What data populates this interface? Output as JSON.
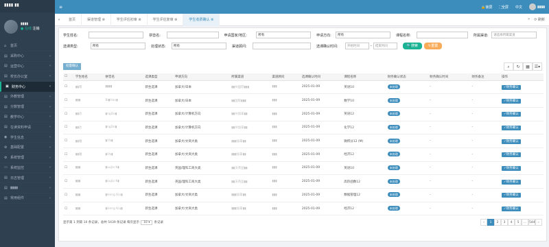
{
  "app": {
    "logo": "▮▮▮▮ ▮▮"
  },
  "user": {
    "name": "▮▮▮▮",
    "status": "● 在线",
    "logout": "注销"
  },
  "sidebar": {
    "items": [
      {
        "label": "首页",
        "icon": "home-icon",
        "glyph": "⌂"
      },
      {
        "label": "采购中心",
        "icon": "folder-icon",
        "glyph": "▤"
      },
      {
        "label": "运营中心",
        "icon": "folder-icon",
        "glyph": "▤"
      },
      {
        "label": "校长办公室",
        "icon": "folder-icon",
        "glyph": "▤"
      },
      {
        "label": "财务中心",
        "icon": "money-icon",
        "glyph": "▣",
        "active": true
      },
      {
        "label": "外教管理",
        "icon": "folder-icon",
        "glyph": "▤"
      },
      {
        "label": "分数管理",
        "icon": "folder-icon",
        "glyph": "▤"
      },
      {
        "label": "教学中心",
        "icon": "folder-icon",
        "glyph": "▤"
      },
      {
        "label": "在读资料申请",
        "icon": "folder-icon",
        "glyph": "▤"
      },
      {
        "label": "学生信息",
        "icon": "user-icon",
        "glyph": "◉"
      },
      {
        "label": "基础配置",
        "icon": "gear-icon",
        "glyph": "⚙"
      },
      {
        "label": "系统管理",
        "icon": "gear-icon",
        "glyph": "⚙"
      },
      {
        "label": "系统监控",
        "icon": "monitor-icon",
        "glyph": "▭"
      },
      {
        "label": "日志管理",
        "icon": "log-icon",
        "glyph": "▤"
      },
      {
        "label": "▮▮▮▮",
        "icon": "folder-icon",
        "glyph": "▤"
      },
      {
        "label": "常用组件",
        "icon": "folder-icon",
        "glyph": "▤"
      }
    ]
  },
  "topbar": {
    "lock": "🔒锁屏",
    "fullscreen": "⛶全屏",
    "lang": "中文",
    "username": "▮▮▮▮"
  },
  "tabs": {
    "items": [
      "首页",
      "渠道管理 ⊗",
      "学生评估初审 ⊗",
      "学生评估复审 ⊗",
      "学生收费确认 ⊗"
    ],
    "active_index": 4,
    "refresh": "⟳ 刷新",
    "close": "»"
  },
  "filters": {
    "student_name": "学生姓名:",
    "pinyin": "拼音名:",
    "apply_country": "申请国家/地区:",
    "country_value": "所有",
    "apply_direction": "申请方向:",
    "direction_value": "所有",
    "course_name": "课程名称:",
    "channel": "所属渠道:",
    "channel_placeholder": "请选择所属渠道",
    "course_type": "选课类型:",
    "type_value": "所有",
    "process_status": "处理状态:",
    "status_value": "所有",
    "consultant": "渠道顾问:",
    "confirm_time": "选课确认时间:",
    "start_placeholder": "开始时间",
    "sep": "-",
    "end_placeholder": "结束时间",
    "search": "🔍搜索",
    "reset": "↻重置"
  },
  "toolbar": {
    "batch": "批量确认",
    "tools": [
      "⌕",
      "↻",
      "▦",
      "☰▾"
    ]
  },
  "table": {
    "headers": [
      "学生姓名",
      "拼音名",
      "选课类型",
      "申请方向",
      "所属渠道",
      "渠道顾问",
      "选课确认时间",
      "课程名称",
      "财务确认状态",
      "财务确认时间",
      "财务备注",
      "操作"
    ],
    "rows": [
      [
        "▮▮雨",
        "▮▮▮▮",
        "新生选课",
        "加拿大/日本",
        "▮▮州国际▮▮▮",
        "▮▮▮",
        "2025-01-09",
        "英语10",
        "未处理",
        "-",
        "-",
        "✓财务确认"
      ],
      [
        "▮▮▮",
        "Bi▮Han▮",
        "新生选课",
        "加拿大/日本",
        "▮▮国际▮▮▮",
        "▮▮▮",
        "2025-01-09",
        "数学10",
        "未处理",
        "-",
        "-",
        "✓财务确认"
      ],
      [
        "▮▮达",
        "▮ngDo▮",
        "新生选课",
        "加拿大/计算机方向",
        "▮▮州加拿▮▮",
        "▮▮▮",
        "2025-01-09",
        "英语12",
        "未处理",
        "-",
        "-",
        "✓财务确认"
      ],
      [
        "▮▮达",
        "▮ngDo▮",
        "新生选课",
        "加拿大/计算机方向",
        "▮▮州加拿▮▮",
        "▮▮▮",
        "2025-01-09",
        "化学12",
        "未处理",
        "-",
        "-",
        "✓财务确认"
      ],
      [
        "▮▮雅",
        "▮iYa▮",
        "新生选课",
        "加拿大/文商大类",
        "▮▮▮加拿▮▮",
        "▮▮▮",
        "2025-01-09",
        "微积分12 (M)",
        "未处理",
        "-",
        "-",
        "✓财务确认"
      ],
      [
        "▮▮雅",
        "▮iYa▮",
        "新生选课",
        "加拿大/文商大类",
        "▮▮▮加拿▮▮",
        "▮▮▮",
        "2025-01-09",
        "经济12",
        "未处理",
        "-",
        "-",
        "✓财务确认"
      ],
      [
        "▮▮▮",
        "▮ouJia K▮",
        "新生选课",
        "英国/理科工商大类",
        "▮▮沃英国▮▮",
        "▮▮▮",
        "2025-01-09",
        "英语10",
        "未处理",
        "-",
        "-",
        "✓财务确认"
      ],
      [
        "▮▮▮",
        "▮ouJia K▮",
        "新生选课",
        "英国/理科工商大类",
        "▮▮沃英国▮▮",
        "▮▮▮",
        "2025-01-09",
        "高阶函数12",
        "未处理",
        "-",
        "-",
        "✓财务确认"
      ],
      [
        "▮▮▮",
        "▮Heng Kio▮",
        "新生选课",
        "加拿大/文商大类",
        "▮▮▮加拿▮▮",
        "▮▮▮",
        "2025-01-09",
        "数据管理12",
        "未处理",
        "-",
        "-",
        "✓财务确认"
      ],
      [
        "▮▮▮",
        "▮Heng Kiq▮",
        "新生选课",
        "加拿大/文商大类",
        "▮▮▮加拿▮▮",
        "▮▮▮",
        "2025-01-09",
        "经济12",
        "未处理",
        "-",
        "-",
        "✓财务确认"
      ]
    ]
  },
  "footer": {
    "summary": "显示第 1 到第 10 条记录，总共 5439 条记录 每页显示",
    "page_size": "10 ▾",
    "suffix": "条记录",
    "pages": [
      "‹",
      "1",
      "2",
      "3",
      "4",
      "5",
      "...",
      "544",
      "›"
    ],
    "current_page": "1"
  },
  "colors": {
    "sidebar": "#2f4050",
    "topbar": "#3c8dbc",
    "accent": "#1ab394",
    "warn": "#f8ac59"
  }
}
